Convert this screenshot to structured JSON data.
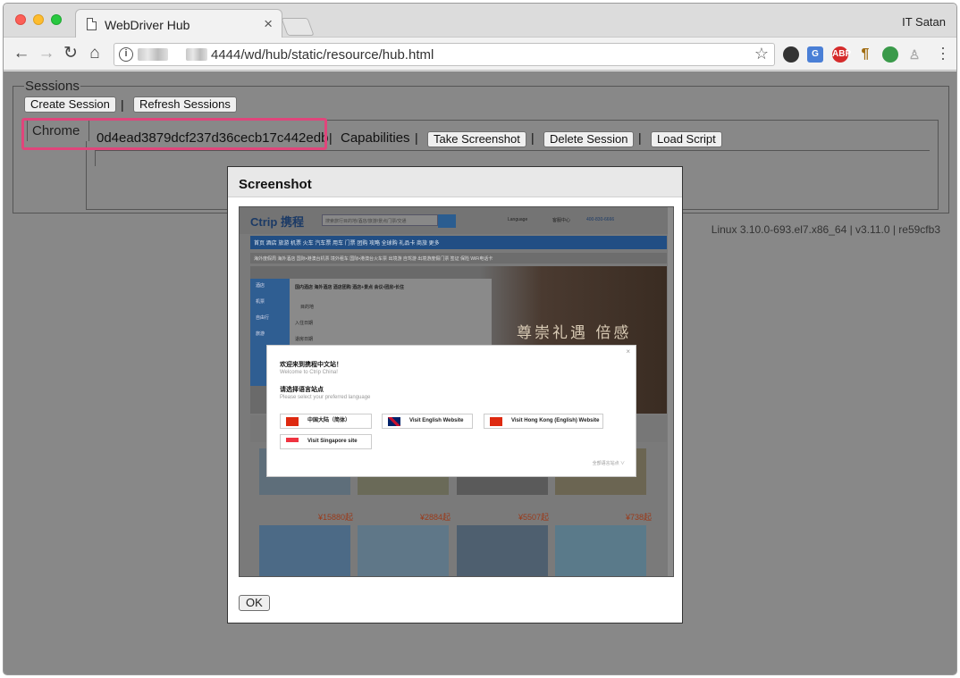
{
  "browser": {
    "tab_title": "WebDriver Hub",
    "profile_name": "IT Satan",
    "url_suffix": "4444/wd/hub/static/resource/hub.html"
  },
  "sessions": {
    "legend": "Sessions",
    "create_label": "Create Session",
    "refresh_label": "Refresh Sessions",
    "separator": "|",
    "browser_label": "Chrome",
    "session_id": "0d4ead3879dcf237d36cecb17c442edb",
    "capabilities_label": "Capabilities",
    "screenshot_label": "Take Screenshot",
    "delete_label": "Delete Session",
    "load_script_label": "Load Script"
  },
  "footer": {
    "version_info": "Linux 3.10.0-693.el7.x86_64  |  v3.11.0  |  re59cfb3"
  },
  "dialog": {
    "title": "Screenshot",
    "ok_label": "OK"
  },
  "site_shot": {
    "logo": "Ctrip 携程",
    "search_placeholder": "搜索旅行目的地/酒店/旅游/景点门票/交通",
    "language_label": "Language",
    "service_center": "客服中心",
    "phone": "400-830-6666",
    "nav_text": "首页  酒店  旅游  机票  火车  汽车票  用车  门票  团购  攻略  全球购  礼品卡  商旅  更多",
    "sub_text": "海外度假周   海外酒店   国际•港澳台机票   境外租车   国际•港澳台火车票   出境游   自驾游   出境游度假门票   签证   保险   WiFi电话卡",
    "form_tabs": "国内酒店   海外酒店   酒店团购   酒店+景点   会议•团房•长住",
    "side_items": [
      "酒店",
      "机票",
      "自由行",
      "旅游"
    ],
    "dest_label": "目的地",
    "checkin_label": "入住日期",
    "checkout_label": "退房日期",
    "hero_text": "尊崇礼遇 倍感",
    "popup": {
      "title_cn": "欢迎来到携程中文站！",
      "title_en": "Welcome to Ctrip China!",
      "select_cn": "请选择语言站点",
      "select_en": "Please select your preferred language",
      "opt_cn": "中国大陆（简体）",
      "opt_en": "Visit English Website",
      "opt_hk": "Visit Hong Kong (English) Website",
      "opt_sg": "Visit Singapore site",
      "more": "全部语言站点 ∨"
    },
    "prices": [
      "15880",
      "2884",
      "5507",
      "738"
    ],
    "price_suffix": "起"
  }
}
